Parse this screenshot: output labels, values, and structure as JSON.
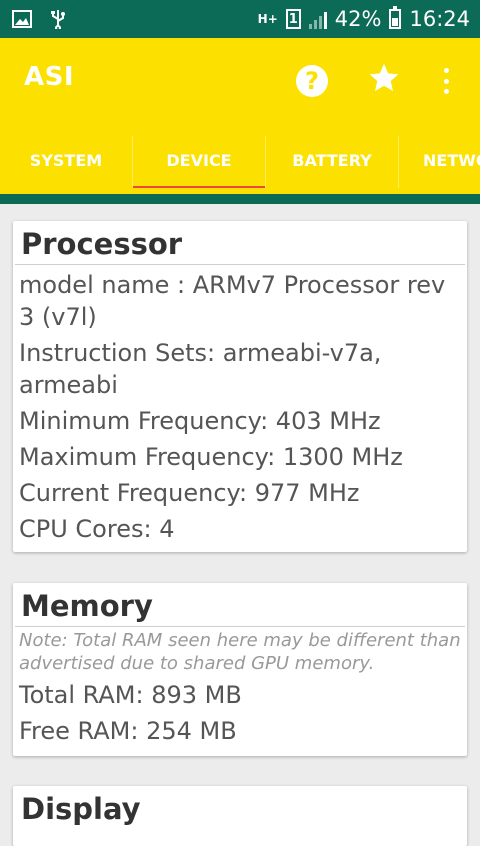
{
  "status": {
    "network_type": "H+",
    "sim_slot": "1",
    "battery": "42%",
    "time": "16:24"
  },
  "app": {
    "title": "ASI"
  },
  "tabs": [
    {
      "label": "SYSTEM"
    },
    {
      "label": "DEVICE"
    },
    {
      "label": "BATTERY"
    },
    {
      "label": "NETWO"
    }
  ],
  "processor": {
    "title": "Processor",
    "model_name": "model name : ARMv7 Processor rev 3 (v7l)",
    "instruction_sets": "Instruction Sets: armeabi-v7a, armeabi",
    "min_freq": "Minimum Frequency: 403 MHz",
    "max_freq": "Maximum Frequency: 1300 MHz",
    "cur_freq": "Current Frequency: 977 MHz",
    "cores": "CPU Cores: 4"
  },
  "memory": {
    "title": "Memory",
    "note": "Note: Total RAM seen here may be different than advertised due to shared GPU memory.",
    "total_ram": "Total RAM: 893 MB",
    "free_ram": "Free RAM: 254 MB"
  },
  "display": {
    "title": "Display"
  },
  "colors": {
    "appbar": "#fce100",
    "statusbar": "#0b6b57",
    "tab_indicator": "#e94a3a"
  }
}
